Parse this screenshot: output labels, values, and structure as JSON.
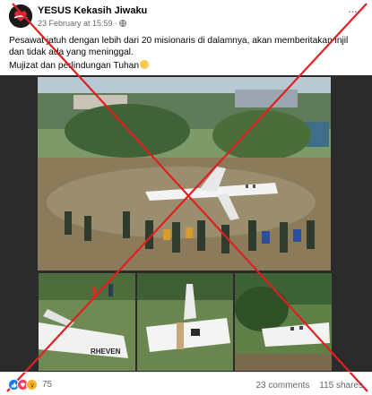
{
  "post": {
    "page_name": "YESUS Kekasih Jiwaku",
    "timestamp": "23 February at 15:59",
    "separator": "·",
    "more_label": "···",
    "caption_line1": "Pesawat jatuh dengan lebih dari 20 misionaris di dalamnya, akan memberitakan injil dan tidak ada yang meninggal.",
    "caption_line2": "Mujizat dan perlindungan Tuhan",
    "icons": {
      "avatar": "heart-logo-avatar",
      "audience": "globe-icon",
      "emoji": "smiling-face-emoji"
    }
  },
  "media": {
    "photos": [
      "main-crash-scene",
      "crash-detail-left",
      "crash-detail-middle",
      "crash-detail-right"
    ],
    "plane_registration": "RHEVEN",
    "overlay": "red-x-false-marker"
  },
  "footer": {
    "reaction_icons": [
      "like-icon",
      "love-icon",
      "wow-icon"
    ],
    "reaction_count": "75",
    "comments": "23 comments",
    "shares": "115 shares"
  },
  "colors": {
    "cross_red": "#e02020",
    "like_blue": "#1877f2",
    "love_red": "#f33e58",
    "wow_yellow": "#f7b125",
    "meta_gray": "#65676b"
  }
}
